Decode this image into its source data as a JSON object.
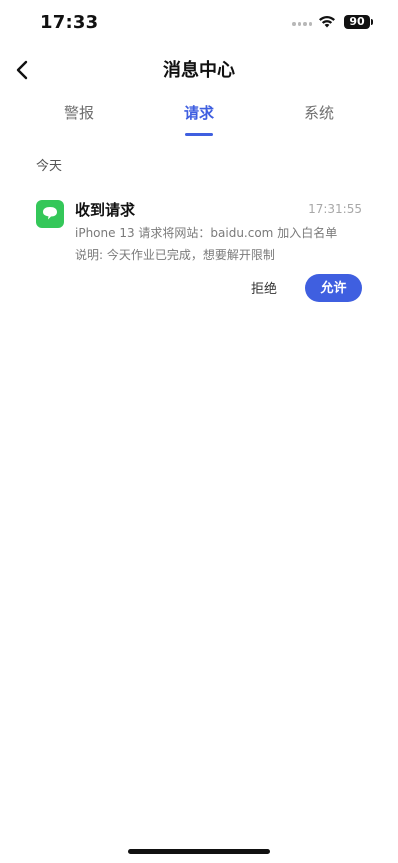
{
  "status_bar": {
    "time": "17:33",
    "battery": "90",
    "icons": [
      "signal-dots-icon",
      "wifi-icon",
      "battery-icon"
    ]
  },
  "nav": {
    "title": "消息中心",
    "back_icon": "chevron-left-icon"
  },
  "tabs": [
    {
      "label": "警报",
      "active": false
    },
    {
      "label": "请求",
      "active": true
    },
    {
      "label": "系统",
      "active": false
    }
  ],
  "section": {
    "heading": "今天"
  },
  "message": {
    "icon": "chat-bubble-icon",
    "title": "收到请求",
    "time": "17:31:55",
    "line1": "iPhone 13 请求将网站：baidu.com 加入白名单",
    "line2": "说明: 今天作业已完成，想要解开限制",
    "reject_label": "拒绝",
    "allow_label": "允许"
  },
  "colors": {
    "accent": "#3f5fe0",
    "icon_green": "#34c759"
  }
}
